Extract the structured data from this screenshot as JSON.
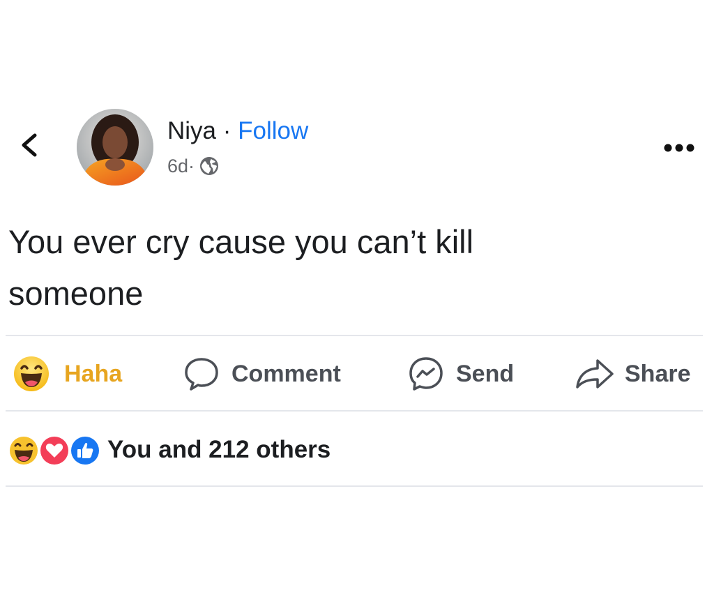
{
  "post": {
    "author_name": "Niya",
    "separator": " · ",
    "follow_label": "Follow",
    "timestamp": "6d",
    "meta_separator": " · ",
    "privacy_icon": "globe-icon",
    "text_lines": [
      "You ever cry cause you can’t kill",
      "someone"
    ]
  },
  "actions": {
    "haha_label": "Haha",
    "comment_label": "Comment",
    "send_label": "Send",
    "share_label": "Share"
  },
  "reactions": {
    "icons": [
      "haha-icon",
      "love-icon",
      "like-icon"
    ],
    "summary": "You and 212 others"
  },
  "colors": {
    "link_blue": "#1877f2",
    "haha_yellow": "#e7a520",
    "love_red": "#f33e58",
    "divider": "#e4e6eb"
  }
}
